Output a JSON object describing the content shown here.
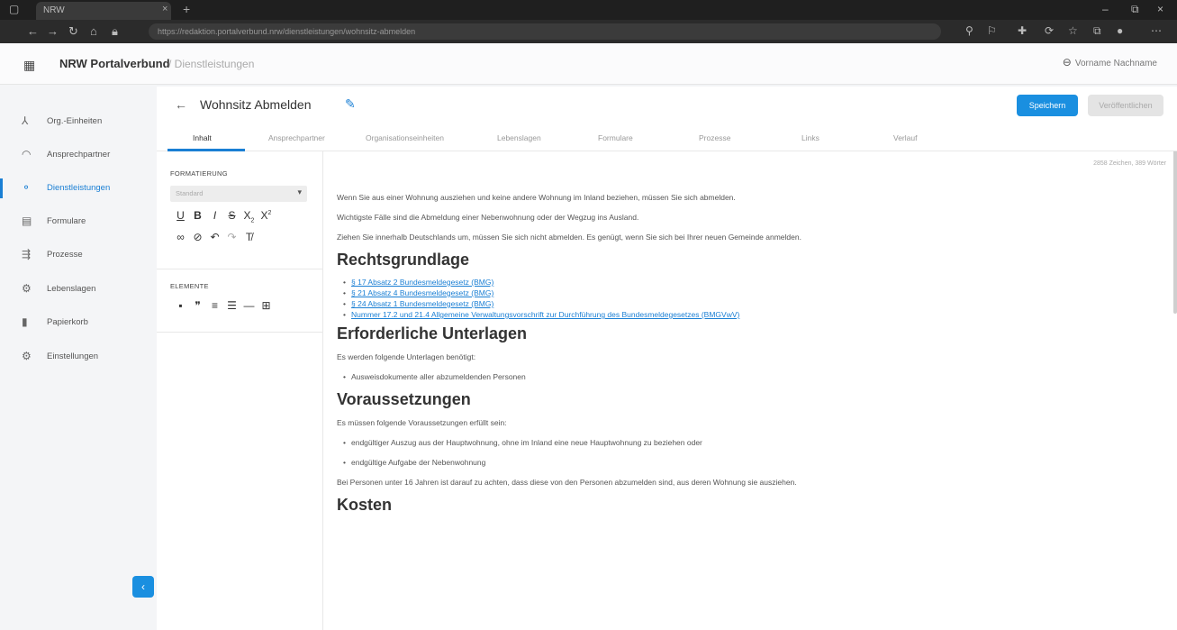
{
  "browser": {
    "tab_title": "NRW",
    "tab_close": "×",
    "new_tab": "+",
    "minimize": "–",
    "maximize": "⧉",
    "close": "×",
    "url": "https://redaktion.portalverbund.nrw/dienstleistungen/wohnsitz-abmelden"
  },
  "header": {
    "brand": "NRW Portalverbund",
    "breadcrumb": "/ Dienstleistungen",
    "user": "Vorname Nachname"
  },
  "sidebar": {
    "items": [
      {
        "label": "Org.-Einheiten",
        "icon": "⅄"
      },
      {
        "label": "Ansprechpartner",
        "icon": "◠"
      },
      {
        "label": "Dienstleistungen",
        "icon": "⚬"
      },
      {
        "label": "Formulare",
        "icon": "▤"
      },
      {
        "label": "Prozesse",
        "icon": "⇶"
      },
      {
        "label": "Lebenslagen",
        "icon": "⚙"
      },
      {
        "label": "Papierkorb",
        "icon": "▮"
      },
      {
        "label": "Einstellungen",
        "icon": "⚙"
      }
    ],
    "collapse": "‹"
  },
  "main": {
    "title": "Wohnsitz Abmelden",
    "save": "Speichern",
    "publish": "Veröffentlichen",
    "tabs": [
      "Inhalt",
      "Ansprechpartner",
      "Organisationseinheiten",
      "Lebenslagen",
      "Formulare",
      "Prozesse",
      "Links",
      "Verlauf"
    ]
  },
  "format_panel": {
    "formatting_title": "FORMATIERUNG",
    "style_select": "Standard",
    "elements_title": "ELEMENTE"
  },
  "editor": {
    "counter": "2858 Zeichen, 389 Wörter",
    "p1": "Wenn Sie aus einer Wohnung ausziehen und keine andere Wohnung im Inland beziehen, müssen Sie sich abmelden.",
    "p2": "Wichtigste Fälle sind die Abmeldung einer Nebenwohnung oder der Wegzug ins Ausland.",
    "p3": "Ziehen Sie innerhalb Deutschlands um, müssen Sie sich nicht abmelden. Es genügt, wenn Sie sich bei Ihrer neuen Gemeinde anmelden.",
    "h1": "Rechtsgrundlage",
    "links": [
      "§ 17 Absatz 2 Bundesmeldegesetz (BMG)",
      "§ 21 Absatz 4 Bundesmeldegesetz (BMG)",
      "§ 24 Absatz 1 Bundesmeldegesetz (BMG)",
      "Nummer 17.2 und 21.4 Allgemeine Verwaltungsvorschrift zur Durchführung des Bundesmeldegesetzes (BMGVwV)"
    ],
    "h2": "Erforderliche Unterlagen",
    "p4": "Es werden folgende Unterlagen benötigt:",
    "b1": "Ausweisdokumente aller abzumeldenden Personen",
    "h3": "Voraussetzungen",
    "p5": "Es müssen folgende Voraussetzungen erfüllt sein:",
    "b2": "endgültiger Auszug aus der Hauptwohnung, ohne im Inland eine neue Hauptwohnung zu beziehen oder",
    "b3": "endgültige Aufgabe der Nebenwohnung",
    "p6": "Bei Personen unter 16 Jahren ist darauf zu achten, dass diese von den Personen abzumelden sind, aus deren Wohnung sie ausziehen.",
    "h4": "Kosten"
  }
}
